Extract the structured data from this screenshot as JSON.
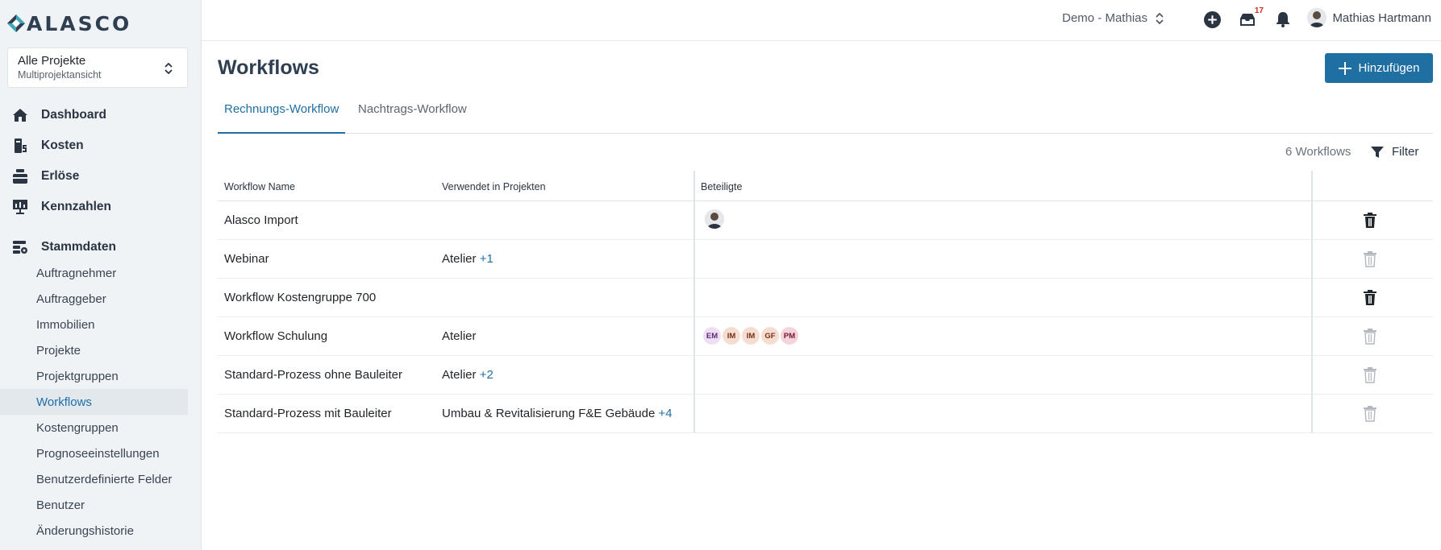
{
  "app": {
    "logo_text": "ALASCO"
  },
  "project_select": {
    "title": "Alle Projekte",
    "subtitle": "Multiprojektansicht"
  },
  "nav": {
    "main": [
      {
        "label": "Dashboard",
        "icon": "home-icon"
      },
      {
        "label": "Kosten",
        "icon": "costs-icon"
      },
      {
        "label": "Erlöse",
        "icon": "revenue-icon"
      },
      {
        "label": "Kennzahlen",
        "icon": "metrics-icon"
      }
    ],
    "section": {
      "label": "Stammdaten",
      "icon": "master-data-icon"
    },
    "sub": [
      {
        "label": "Auftragnehmer"
      },
      {
        "label": "Auftraggeber"
      },
      {
        "label": "Immobilien"
      },
      {
        "label": "Projekte"
      },
      {
        "label": "Projektgruppen"
      },
      {
        "label": "Workflows",
        "active": true
      },
      {
        "label": "Kostengruppen"
      },
      {
        "label": "Prognoseeinstellungen"
      },
      {
        "label": "Benutzerdefinierte Felder"
      },
      {
        "label": "Benutzer"
      },
      {
        "label": "Änderungshistorie"
      }
    ]
  },
  "header": {
    "tenant": "Demo - Mathias",
    "inbox_badge": "17",
    "user_name": "Mathias Hartmann"
  },
  "page": {
    "title": "Workflows",
    "add_button": "Hinzufügen",
    "tabs": [
      {
        "label": "Rechnungs-Workflow",
        "active": true
      },
      {
        "label": "Nachtrags-Workflow",
        "active": false
      }
    ],
    "count": "6 Workflows",
    "filter_label": "Filter"
  },
  "table": {
    "columns": [
      "Workflow Name",
      "Verwendet in Projekten",
      "Beteiligte"
    ],
    "rows": [
      {
        "name": "Alasco Import",
        "projects": "",
        "extra": "",
        "participants": "avatar",
        "trash_enabled": true
      },
      {
        "name": "Webinar",
        "projects": "Atelier",
        "extra": "+1",
        "participants": "",
        "trash_enabled": false
      },
      {
        "name": "Workflow Kostengruppe 700",
        "projects": "",
        "extra": "",
        "participants": "",
        "trash_enabled": true
      },
      {
        "name": "Workflow Schulung",
        "projects": "Atelier",
        "extra": "",
        "participants": [
          "EM",
          "IM",
          "IM",
          "GF",
          "PM"
        ],
        "trash_enabled": false
      },
      {
        "name": "Standard-Prozess ohne Bauleiter",
        "projects": "Atelier",
        "extra": "+2",
        "participants": "",
        "trash_enabled": false
      },
      {
        "name": "Standard-Prozess mit Bauleiter",
        "projects": "Umbau & Revitalisierung F&E Gebäude",
        "extra": "+4",
        "participants": "",
        "trash_enabled": false
      }
    ]
  },
  "colors": {
    "accent": "#1f6fa3",
    "badge": "#d62a2a",
    "sidebar_bg": "#f0f3f6"
  }
}
